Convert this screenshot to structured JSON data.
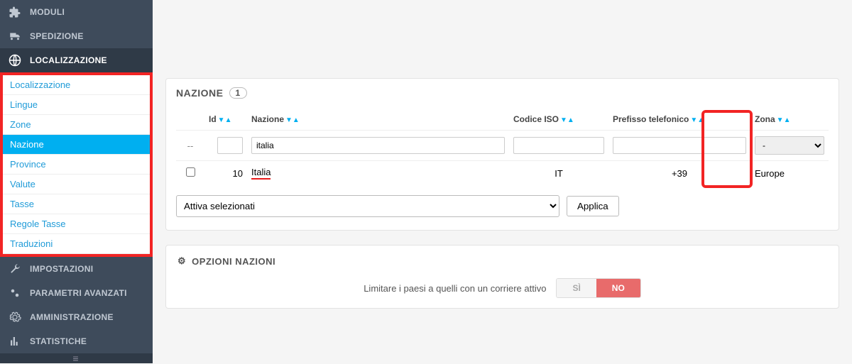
{
  "sidebar": {
    "main": [
      {
        "label": "MODULI",
        "icon": "puzzle"
      },
      {
        "label": "SPEDIZIONE",
        "icon": "truck"
      },
      {
        "label": "LOCALIZZAZIONE",
        "icon": "globe",
        "active": true
      }
    ],
    "sub": [
      "Localizzazione",
      "Lingue",
      "Zone",
      "Nazione",
      "Province",
      "Valute",
      "Tasse",
      "Regole Tasse",
      "Traduzioni"
    ],
    "sub_active": "Nazione",
    "after": [
      {
        "label": "IMPOSTAZIONI",
        "icon": "wrench"
      },
      {
        "label": "PARAMETRI AVANZATI",
        "icon": "gears"
      },
      {
        "label": "AMMINISTRAZIONE",
        "icon": "gear"
      },
      {
        "label": "STATISTICHE",
        "icon": "stats"
      }
    ]
  },
  "panel": {
    "title": "NAZIONE",
    "count": "1",
    "headers": {
      "id": "Id",
      "nazione": "Nazione",
      "iso": "Codice ISO",
      "prefisso": "Prefisso telefonico",
      "zona": "Zona"
    },
    "filter": {
      "nazione_value": "italia",
      "zona_value": "-"
    },
    "row": {
      "id": "10",
      "nazione": "Italia",
      "iso": "IT",
      "prefisso": "+39",
      "zona": "Europe"
    },
    "bulk": {
      "select_label": "Attiva selezionati",
      "apply_label": "Applica"
    }
  },
  "options": {
    "title": "OPZIONI NAZIONI",
    "toggle_label": "Limitare i paesi a quelli con un corriere attivo",
    "yes": "SÌ",
    "no": "NO"
  }
}
